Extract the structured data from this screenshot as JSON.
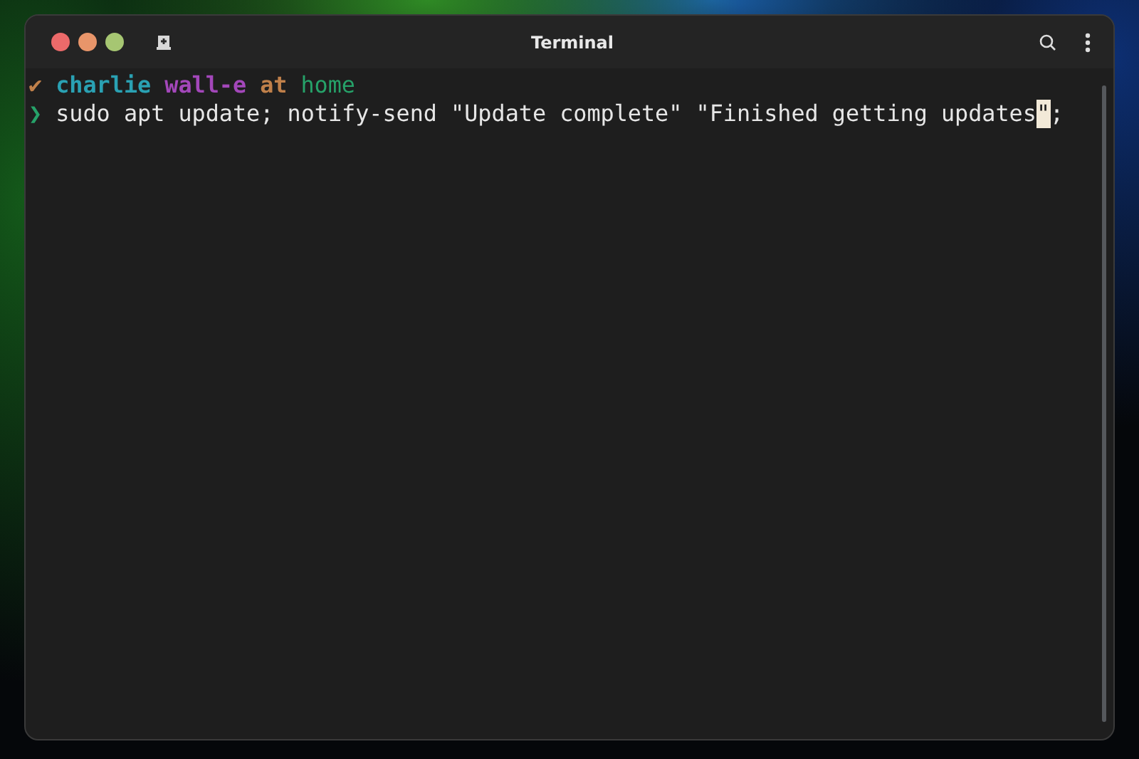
{
  "window": {
    "title": "Terminal"
  },
  "prompt": {
    "status": "✔",
    "segments": [
      {
        "text": "charlie",
        "color": "#2aa1b3",
        "bold": true
      },
      {
        "text": "wall-e",
        "color": "#a347ba",
        "bold": true
      },
      {
        "text": "at",
        "color": "#c0804a",
        "bold": true
      },
      {
        "text": "home",
        "color": "#26a269",
        "bold": false
      }
    ]
  },
  "input": {
    "symbol": "❯",
    "before": "sudo apt update; notify-send \"Update complete\" \"Finished getting updates",
    "cursor": "\"",
    "after": ";"
  }
}
